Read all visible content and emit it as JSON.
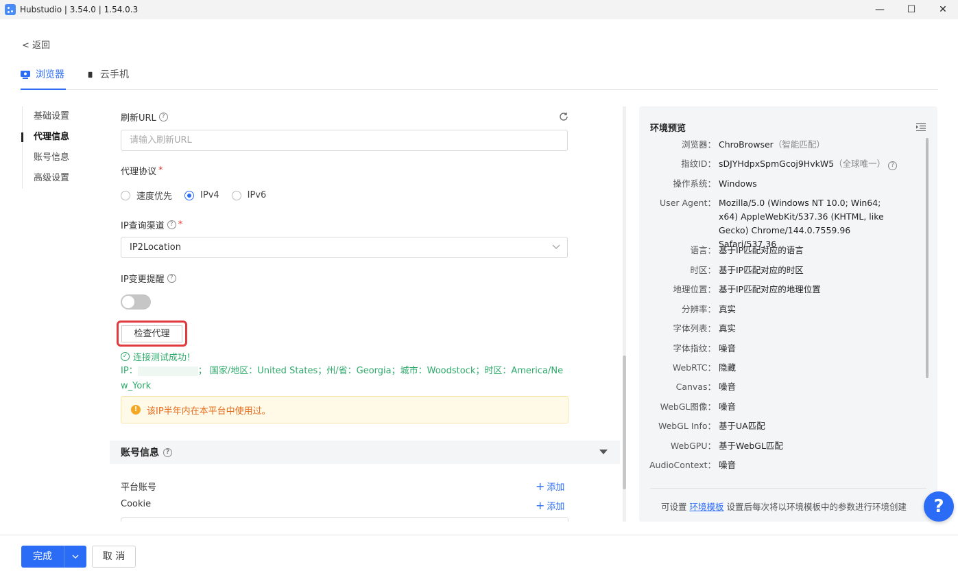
{
  "window": {
    "title": "Hubstudio | 3.54.0 | 1.54.0.3"
  },
  "nav": {
    "back_label": "< 返回"
  },
  "tabs": [
    {
      "label": "浏览器",
      "active": true
    },
    {
      "label": "云手机",
      "active": false
    }
  ],
  "sidebar": {
    "items": [
      {
        "label": "基础设置"
      },
      {
        "label": "代理信息",
        "active": true
      },
      {
        "label": "账号信息"
      },
      {
        "label": "高级设置"
      }
    ]
  },
  "form": {
    "refresh_url": {
      "label": "刷新URL",
      "placeholder": "请输入刷新URL"
    },
    "protocol": {
      "label": "代理协议",
      "required_mark": "*",
      "options": [
        "速度优先",
        "IPv4",
        "IPv6"
      ],
      "selected": "IPv4"
    },
    "ip_channel": {
      "label": "IP查询渠道",
      "required_mark": "*",
      "value": "IP2Location"
    },
    "ip_change_alert": {
      "label": "IP变更提醒",
      "enabled": false
    },
    "check_button": "检查代理",
    "success_text": "连接测试成功！",
    "ip_prefix": "IP：",
    "ip_suffix": "；",
    "ip_details": "国家/地区：United States；州/省：Georgia；城市：Woodstock；时区：America/New_York",
    "warning": "该IP半年内在本平台中使用过。"
  },
  "account_section": {
    "title": "账号信息",
    "platform_label": "平台账号",
    "cookie_label": "Cookie",
    "add_label": "添加"
  },
  "preview": {
    "title": "环境预览",
    "rows": [
      {
        "key": "浏览器：",
        "value": "ChroBrowser",
        "hint": "（智能匹配）"
      },
      {
        "key": "指纹ID：",
        "value": "sDJYHdpxSpmGcoj9HvkW5",
        "hint": "（全球唯一）"
      },
      {
        "key": "操作系统：",
        "value": "Windows"
      },
      {
        "key": "User Agent：",
        "value": "Mozilla/5.0 (Windows NT 10.0; Win64; x64) AppleWebKit/537.36 (KHTML, like Gecko) Chrome/144.0.7559.96 Safari/537.36"
      },
      {
        "key": "语言：",
        "value": "基于IP匹配对应的语言"
      },
      {
        "key": "时区：",
        "value": "基于IP匹配对应的时区"
      },
      {
        "key": "地理位置：",
        "value": "基于IP匹配对应的地理位置"
      },
      {
        "key": "分辨率：",
        "value": "真实"
      },
      {
        "key": "字体列表：",
        "value": "真实"
      },
      {
        "key": "字体指纹：",
        "value": "噪音"
      },
      {
        "key": "WebRTC：",
        "value": "隐藏"
      },
      {
        "key": "Canvas：",
        "value": "噪音"
      },
      {
        "key": "WebGL图像：",
        "value": "噪音"
      },
      {
        "key": "WebGL Info：",
        "value": "基于UA匹配"
      },
      {
        "key": "WebGPU：",
        "value": "基于WebGL匹配"
      },
      {
        "key": "AudioContext：",
        "value": "噪音"
      }
    ],
    "footer_prefix": "可设置 ",
    "footer_link": "环境模板",
    "footer_suffix": " 设置后每次将以环境模板中的参数进行环境创建"
  },
  "help_button": "?",
  "footer": {
    "done_label": "完成",
    "cancel_label": "取 消"
  },
  "colors": {
    "accent": "#2b6cf6",
    "success": "#2eaa6b",
    "warning": "#e36b1c",
    "highlight_border": "#e0393e"
  }
}
